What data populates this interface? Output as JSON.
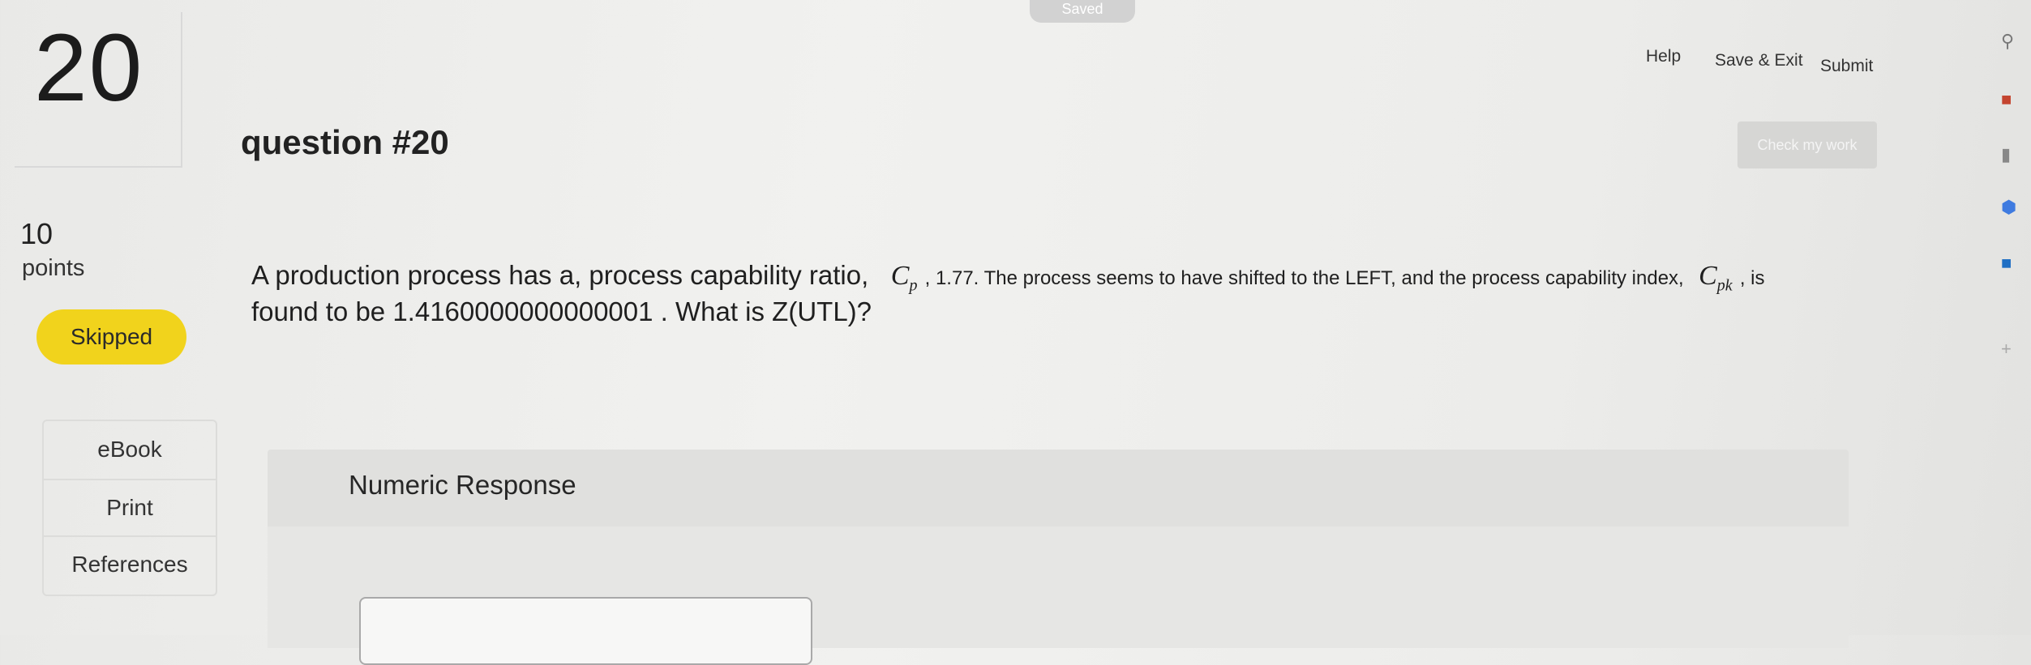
{
  "header": {
    "saved_status": "Saved",
    "question_number": "20",
    "question_title": "question #20",
    "nav": {
      "help": "Help",
      "save_exit": "Save & Exit",
      "submit": "Submit"
    },
    "check_work": "Check my work"
  },
  "sidebar": {
    "points_value": "10",
    "points_label": "points",
    "status_badge": "Skipped",
    "links": [
      "eBook",
      "Print",
      "References"
    ]
  },
  "question": {
    "part1": "A production process has a, process capability ratio,",
    "cp_symbol": "C",
    "cp_sub": "p",
    "part2": ", 1.77. The process seems to have shifted to the LEFT, and the process capability index,",
    "cpk_symbol": "C",
    "cpk_sub": "pk",
    "part3": ", is",
    "part4": "found to be 1.4160000000000001 . What is Z(UTL)?"
  },
  "response": {
    "title": "Numeric Response",
    "input_value": ""
  },
  "right_rail": {
    "icons": [
      "search-icon",
      "gift-icon",
      "chart-icon",
      "hexagon-icon",
      "outlook-icon",
      "plus-icon"
    ]
  },
  "colors": {
    "skipped_badge": "#f1d31c",
    "check_button": "#d6d6d4",
    "response_panel": "#e0e0de"
  }
}
